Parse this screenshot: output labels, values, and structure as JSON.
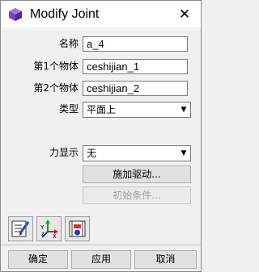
{
  "window": {
    "title": "Modify Joint",
    "close_glyph": "✕"
  },
  "form": {
    "name_label": "名称",
    "name_value": "a_4",
    "body1_label": "第1个物体",
    "body1_value": "ceshijian_1",
    "body2_label": "第2个物体",
    "body2_value": "ceshijian_2",
    "type_label": "类型",
    "type_value": "平面上",
    "force_display_label": "力显示",
    "force_display_value": "无"
  },
  "buttons": {
    "impose_motion": "施加驱动...",
    "initial_conditions": "初始条件...",
    "ok": "确定",
    "apply": "应用",
    "cancel": "取消"
  },
  "toolbar_icons": [
    "edit-note-icon",
    "coordinate-axes-icon",
    "joint-data-icon"
  ]
}
